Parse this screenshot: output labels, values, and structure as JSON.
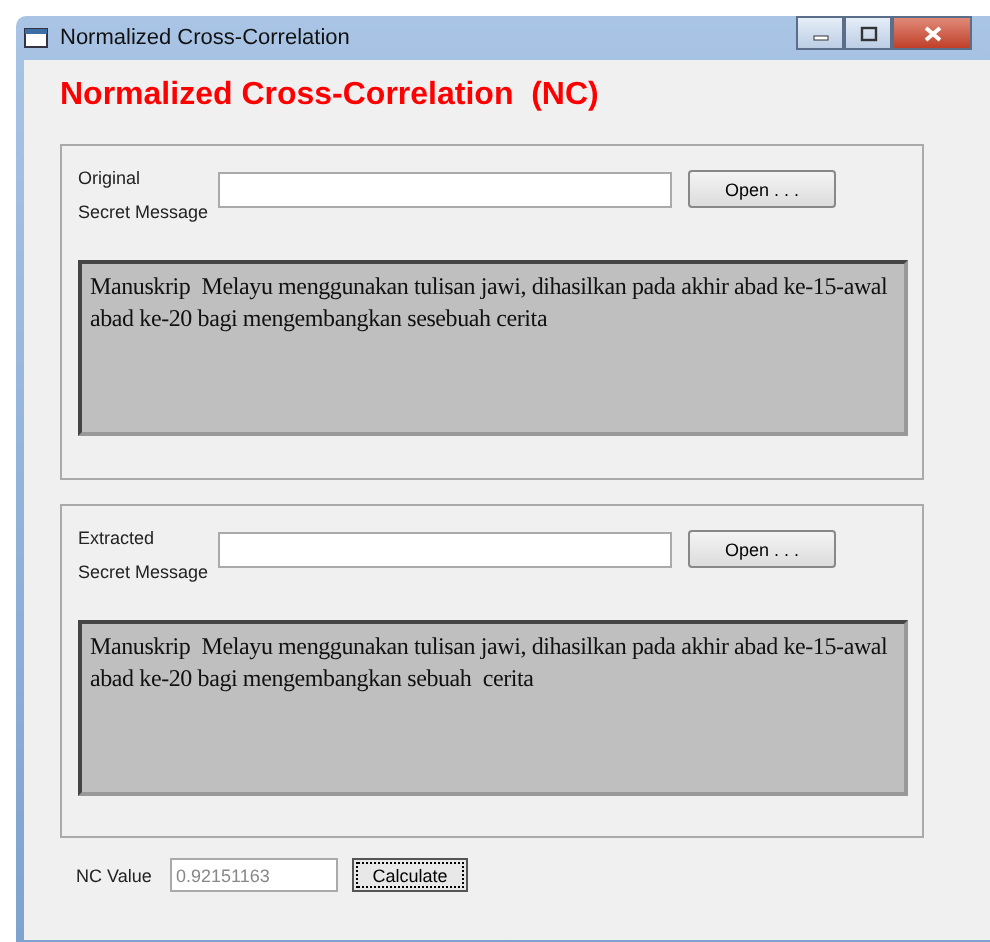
{
  "window": {
    "title": "Normalized Cross-Correlation"
  },
  "heading": "Normalized Cross-Correlation  (NC)",
  "groups": [
    {
      "label_lines": [
        "Original",
        "Secret Message"
      ],
      "button": "Open . . .",
      "text": "Manuskrip  Melayu menggunakan tulisan jawi, dihasilkan pada akhir abad ke-15-awal abad ke-20 bagi mengembangkan sesebuah cerita"
    },
    {
      "label_lines": [
        "Extracted",
        "Secret Message"
      ],
      "button": "Open . . .",
      "text": "Manuskrip  Melayu menggunakan tulisan jawi, dihasilkan pada akhir abad ke-15-awal abad ke-20 bagi mengembangkan sebuah  cerita"
    }
  ],
  "nc": {
    "label": "NC Value",
    "value": "0.92151163",
    "disabled": true,
    "button": "Calculate"
  }
}
